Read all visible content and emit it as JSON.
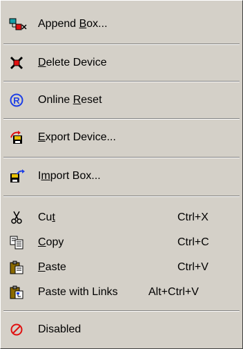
{
  "menu": {
    "items": [
      {
        "label_pre": "Append ",
        "label_u": "B",
        "label_post": "ox...",
        "shortcut": "",
        "icon": "append-box-icon"
      },
      {
        "label_pre": "",
        "label_u": "D",
        "label_post": "elete Device",
        "shortcut": "",
        "icon": "delete-device-icon"
      },
      {
        "label_pre": "Online ",
        "label_u": "R",
        "label_post": "eset",
        "shortcut": "",
        "icon": "online-reset-icon"
      },
      {
        "label_pre": "",
        "label_u": "E",
        "label_post": "xport Device...",
        "shortcut": "",
        "icon": "export-device-icon"
      },
      {
        "label_pre": "I",
        "label_u": "m",
        "label_post": "port Box...",
        "shortcut": "",
        "icon": "import-box-icon"
      },
      {
        "label_pre": "Cu",
        "label_u": "t",
        "label_post": "",
        "shortcut": "Ctrl+X",
        "icon": "scissors-icon"
      },
      {
        "label_pre": "",
        "label_u": "C",
        "label_post": "opy",
        "shortcut": "Ctrl+C",
        "icon": "copy-icon"
      },
      {
        "label_pre": "",
        "label_u": "P",
        "label_post": "aste",
        "shortcut": "Ctrl+V",
        "icon": "paste-icon"
      },
      {
        "label_pre": "Paste with Links",
        "label_u": "",
        "label_post": "",
        "shortcut": "Alt+Ctrl+V",
        "icon": "paste-links-icon"
      },
      {
        "label_pre": "Disabled",
        "label_u": "",
        "label_post": "",
        "shortcut": "",
        "icon": "disabled-icon"
      }
    ]
  },
  "colors": {
    "menu_bg": "#d4d0c8",
    "accent_blue": "#1c3ee6",
    "accent_red": "#e01010",
    "accent_teal": "#16a0a8"
  }
}
